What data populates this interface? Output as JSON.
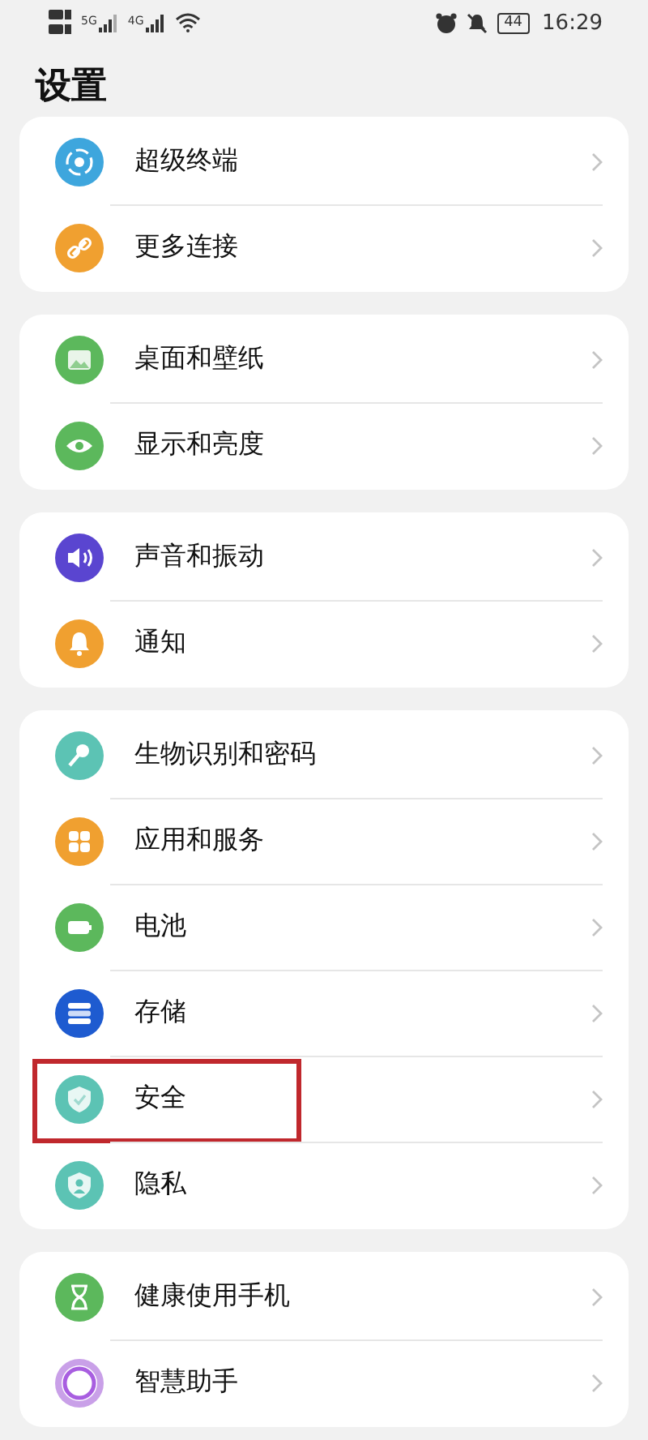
{
  "status_bar": {
    "networks": [
      "5G",
      "4G"
    ],
    "battery": "44",
    "time": "16:29"
  },
  "title": "设置",
  "groups": [
    {
      "items": [
        {
          "label": "超级终端",
          "color": "#3ea6dd",
          "highlighted": false
        },
        {
          "label": "更多连接",
          "color": "#f0a030",
          "highlighted": false
        }
      ]
    },
    {
      "items": [
        {
          "label": "桌面和壁纸",
          "color": "#5cb85c",
          "highlighted": false
        },
        {
          "label": "显示和亮度",
          "color": "#5cb85c",
          "highlighted": false
        }
      ]
    },
    {
      "items": [
        {
          "label": "声音和振动",
          "color": "#5a45d0",
          "highlighted": false
        },
        {
          "label": "通知",
          "color": "#f0a030",
          "highlighted": false
        }
      ]
    },
    {
      "items": [
        {
          "label": "生物识别和密码",
          "color": "#5cc3b4",
          "highlighted": false
        },
        {
          "label": "应用和服务",
          "color": "#f0a030",
          "highlighted": false
        },
        {
          "label": "电池",
          "color": "#5cb85c",
          "highlighted": false
        },
        {
          "label": "存储",
          "color": "#1e5bd0",
          "highlighted": false
        },
        {
          "label": "安全",
          "color": "#5cc3b4",
          "highlighted": true
        },
        {
          "label": "隐私",
          "color": "#5cc3b4",
          "highlighted": false
        }
      ]
    },
    {
      "items": [
        {
          "label": "健康使用手机",
          "color": "#5cb85c",
          "highlighted": false
        },
        {
          "label": "智慧助手",
          "color": "#c9a0e8",
          "highlighted": false
        }
      ]
    }
  ]
}
